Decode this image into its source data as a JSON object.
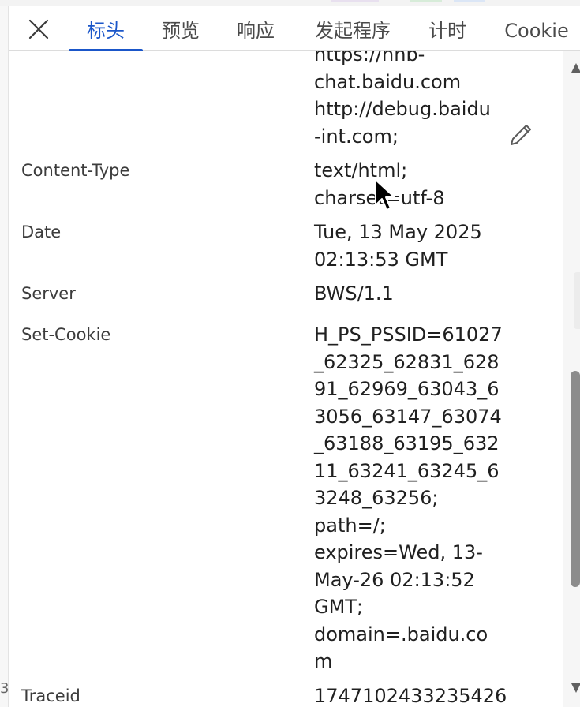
{
  "tabs": [
    {
      "label": "标头",
      "active": true
    },
    {
      "label": "预览",
      "active": false
    },
    {
      "label": "响应",
      "active": false
    },
    {
      "label": "发起程序",
      "active": false
    },
    {
      "label": "计时",
      "active": false
    },
    {
      "label": "Cookie",
      "active": false
    }
  ],
  "headers": [
    {
      "name": "",
      "value": "https://hnb-\nchat.baidu.com\nhttp://debug.baidu\n-int.com;"
    },
    {
      "name": "Content-Type",
      "value": "text/html;\ncharset=utf-8"
    },
    {
      "name": "Date",
      "value": "Tue, 13 May 2025\n02:13:53 GMT"
    },
    {
      "name": "Server",
      "value": "BWS/1.1"
    },
    {
      "name": "Set-Cookie",
      "value": "H_PS_PSSID=61027\n_62325_62831_628\n91_62969_63043_6\n3056_63147_63074\n_63188_63195_632\n11_63241_63245_6\n3248_63256;\npath=/;\nexpires=Wed, 13-\nMay-26 02:13:52\nGMT;\ndomain=.baidu.co\nm"
    },
    {
      "name": "Traceid",
      "value": "1747102433235426"
    }
  ],
  "icons": {
    "close": "close-icon",
    "edit": "pencil-icon",
    "cursor": "mouse-cursor-icon"
  },
  "colors": {
    "accent": "#1a56c9",
    "text": "#202020",
    "label": "#3c3c3c"
  },
  "left_edge_mark": "3"
}
